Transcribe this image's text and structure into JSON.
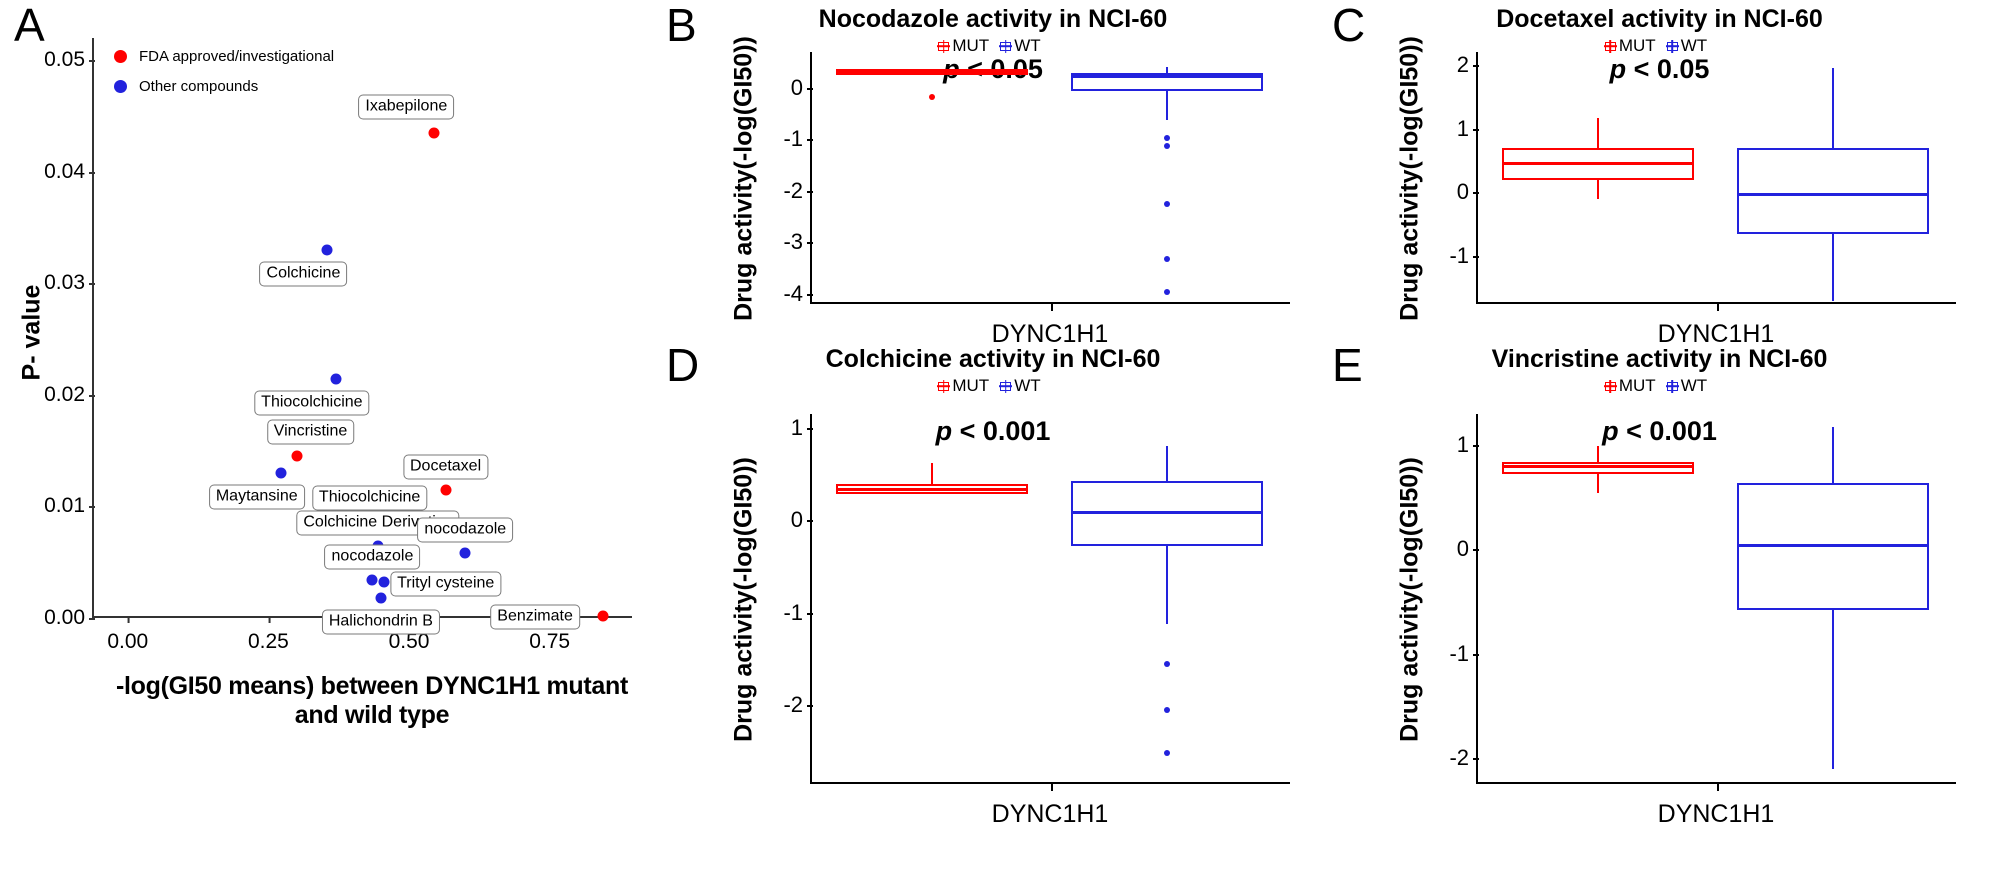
{
  "figure": {
    "panels": [
      "A",
      "B",
      "C",
      "D",
      "E"
    ]
  },
  "colors": {
    "mut_red": "#FF0000",
    "wt_blue": "#2222DD",
    "point_red": "#FF1010",
    "point_blue": "#2020DD",
    "axis": "#333333",
    "label_border": "#7a7a7a"
  },
  "panel_a": {
    "letter": "A",
    "legend": [
      {
        "label": "FDA approved/investigational",
        "color": "#FF0000",
        "icon": "legend-dot-red"
      },
      {
        "label": "Other compounds",
        "color": "#2222DD",
        "icon": "legend-dot-blue"
      }
    ],
    "x_axis_title": "-log(GI50 means) between DYNC1H1 mutant and wild type",
    "y_axis_title": "P- value",
    "y_ticks": [
      "0.00",
      "0.01",
      "0.02",
      "0.03",
      "0.04",
      "0.05"
    ],
    "x_ticks": [
      "0.00",
      "0.25",
      "0.50",
      "0.75"
    ]
  },
  "chart_data": [
    {
      "type": "scatter",
      "panel": "A",
      "title": "",
      "xlabel": "-log(GI50 means) between DYNC1H1 mutant and wild type",
      "ylabel": "P- value",
      "xlim": [
        -0.06,
        0.9
      ],
      "ylim": [
        0.0,
        0.052
      ],
      "grid": false,
      "legend": [
        "FDA approved/investigational",
        "Other compounds"
      ],
      "legend_position": "top-left inside",
      "points": [
        {
          "label": "Ixabepilone",
          "x": 0.545,
          "y": 0.0435,
          "group": "FDA approved/investigational",
          "color": "#FF0000",
          "label_pos": "above-left"
        },
        {
          "label": "Colchicine",
          "x": 0.355,
          "y": 0.033,
          "group": "Other compounds",
          "color": "#2222DD",
          "label_pos": "below-left"
        },
        {
          "label": "Thiocolchicine",
          "x": 0.37,
          "y": 0.0214,
          "group": "Other compounds",
          "color": "#2222DD",
          "label_pos": "below-left"
        },
        {
          "label": "Vincristine",
          "x": 0.3,
          "y": 0.0145,
          "group": "FDA approved/investigational",
          "color": "#FF0000",
          "label_pos": "above-right"
        },
        {
          "label": "Maytansine",
          "x": 0.272,
          "y": 0.013,
          "group": "Other compounds",
          "color": "#2222DD",
          "label_pos": "below-left"
        },
        {
          "label": "Docetaxel",
          "x": 0.565,
          "y": 0.0115,
          "group": "FDA approved/investigational",
          "color": "#FF0000",
          "label_pos": "above-center"
        },
        {
          "label": "Thiocolchicine",
          "x": 0.43,
          "y": 0.0087,
          "group": "Other compounds",
          "color": "#2222DD",
          "label_pos": "above-center"
        },
        {
          "label": "Colchicine Derivative",
          "x": 0.445,
          "y": 0.0065,
          "group": "Other compounds",
          "color": "#2222DD",
          "label_pos": "above-center"
        },
        {
          "label": "nocodazole",
          "x": 0.6,
          "y": 0.0058,
          "group": "Other compounds",
          "color": "#2222DD",
          "label_pos": "above-center"
        },
        {
          "label": "nocodazole",
          "x": 0.435,
          "y": 0.0034,
          "group": "Other compounds",
          "color": "#2222DD",
          "label_pos": "above-center"
        },
        {
          "label": "Trityl cysteine",
          "x": 0.455,
          "y": 0.0032,
          "group": "Other compounds",
          "color": "#2222DD",
          "label_pos": "right"
        },
        {
          "label": "Halichondrin B",
          "x": 0.45,
          "y": 0.0018,
          "group": "Other compounds",
          "color": "#2222DD",
          "label_pos": "below-center"
        },
        {
          "label": "Benzimate",
          "x": 0.845,
          "y": 0.0002,
          "group": "FDA approved/investigational",
          "color": "#FF0000",
          "label_pos": "left"
        }
      ]
    },
    {
      "type": "boxplot",
      "panel": "B",
      "title": "Nocodazole activity in NCI-60",
      "xlabel": "DYNC1H1",
      "ylabel": "Drug activity(-log(GI50))",
      "p_value": "p < 0.05",
      "y_ticks": [
        0,
        -1,
        -2,
        -3,
        -4
      ],
      "ylim": [
        -4.2,
        0.7
      ],
      "grid": false,
      "legend": [
        "MUT",
        "WT"
      ],
      "boxes": [
        {
          "group": "MUT",
          "color": "#FF0000",
          "q1": 0.26,
          "median": 0.31,
          "q3": 0.37,
          "whisker_low": 0.26,
          "whisker_high": 0.37,
          "outliers": [
            -0.17
          ]
        },
        {
          "group": "WT",
          "color": "#2222DD",
          "q1": -0.06,
          "median": 0.22,
          "q3": 0.3,
          "whisker_low": -0.63,
          "whisker_high": 0.4,
          "outliers": [
            -0.98,
            -1.12,
            -2.25,
            -3.32,
            -3.97
          ]
        }
      ]
    },
    {
      "type": "boxplot",
      "panel": "C",
      "title": "Docetaxel activity in NCI-60",
      "xlabel": "DYNC1H1",
      "ylabel": "Drug activity(-log(GI50))",
      "p_value": "p < 0.05",
      "y_ticks": [
        2,
        1,
        0,
        -1
      ],
      "ylim": [
        -1.75,
        2.2
      ],
      "grid": false,
      "legend": [
        "MUT",
        "WT"
      ],
      "boxes": [
        {
          "group": "MUT",
          "color": "#FF0000",
          "q1": 0.19,
          "median": 0.46,
          "q3": 0.69,
          "whisker_low": -0.11,
          "whisker_high": 1.17,
          "outliers": []
        },
        {
          "group": "WT",
          "color": "#2222DD",
          "q1": -0.66,
          "median": -0.03,
          "q3": 0.7,
          "whisker_low": -1.7,
          "whisker_high": 1.95,
          "outliers": []
        }
      ]
    },
    {
      "type": "boxplot",
      "panel": "D",
      "title": "Colchicine activity in NCI-60",
      "xlabel": "DYNC1H1",
      "ylabel": "Drug activity(-log(GI50))",
      "p_value": "p < 0.001",
      "y_ticks": [
        1,
        0,
        -1,
        -2
      ],
      "ylim": [
        -2.85,
        1.15
      ],
      "grid": false,
      "legend": [
        "MUT",
        "WT"
      ],
      "boxes": [
        {
          "group": "MUT",
          "color": "#FF0000",
          "q1": 0.28,
          "median": 0.33,
          "q3": 0.39,
          "whisker_low": 0.28,
          "whisker_high": 0.62,
          "outliers": []
        },
        {
          "group": "WT",
          "color": "#2222DD",
          "q1": -0.28,
          "median": 0.08,
          "q3": 0.43,
          "whisker_low": -1.12,
          "whisker_high": 0.8,
          "outliers": [
            -1.55,
            -2.05,
            -2.52
          ]
        }
      ]
    },
    {
      "type": "boxplot",
      "panel": "E",
      "title": "Vincristine activity in NCI-60",
      "xlabel": "DYNC1H1",
      "ylabel": "Drug activity(-log(GI50))",
      "p_value": "p < 0.001",
      "y_ticks": [
        1,
        0,
        -1,
        -2
      ],
      "ylim": [
        -2.25,
        1.3
      ],
      "grid": false,
      "legend": [
        "MUT",
        "WT"
      ],
      "boxes": [
        {
          "group": "MUT",
          "color": "#FF0000",
          "q1": 0.72,
          "median": 0.8,
          "q3": 0.84,
          "whisker_low": 0.54,
          "whisker_high": 0.99,
          "outliers": []
        },
        {
          "group": "WT",
          "color": "#2222DD",
          "q1": -0.58,
          "median": 0.04,
          "q3": 0.64,
          "whisker_low": -2.11,
          "whisker_high": 1.18,
          "outliers": []
        }
      ]
    }
  ],
  "boxplot_panels": [
    {
      "letter": "B",
      "index": 1
    },
    {
      "letter": "C",
      "index": 2
    },
    {
      "letter": "D",
      "index": 3
    },
    {
      "letter": "E",
      "index": 4
    }
  ]
}
